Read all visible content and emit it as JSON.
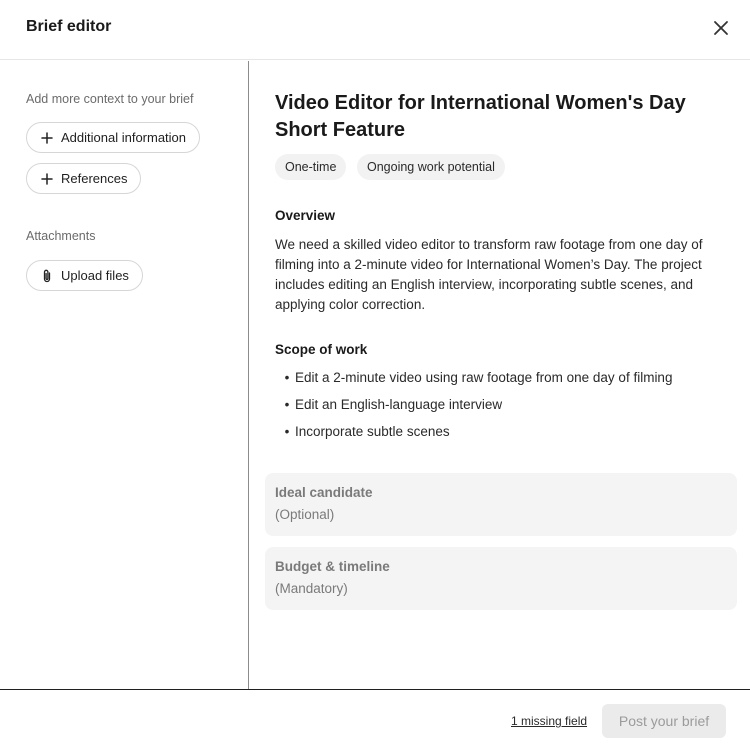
{
  "header": {
    "title": "Brief editor",
    "close_icon": "close-icon"
  },
  "sidebar": {
    "context_label": "Add more context to your brief",
    "additional_info_label": "Additional information",
    "references_label": "References",
    "attachments_label": "Attachments",
    "upload_label": "Upload files"
  },
  "main": {
    "title": "Video Editor for International Women's Day Short Feature",
    "tags": [
      "One-time",
      "Ongoing work potential"
    ],
    "overview_heading": "Overview",
    "overview_text": "We need a skilled video editor to transform raw footage from one day of filming into a 2-minute video for International Women’s Day. The project includes editing an English interview, incorporating subtle scenes, and applying color correction.",
    "scope_heading": "Scope of work",
    "scope_items": [
      "Edit a 2-minute video using raw footage from one day of filming",
      "Edit an English-language interview",
      "Incorporate subtle scenes"
    ],
    "ideal_candidate": {
      "heading": "Ideal candidate",
      "sub": "(Optional)"
    },
    "budget_timeline": {
      "heading": "Budget & timeline",
      "sub": "(Mandatory)"
    }
  },
  "footer": {
    "missing_field_label": "1 missing field",
    "post_label": "Post your brief"
  },
  "colors": {
    "border": "#e6e6e6",
    "card_bg": "#f4f4f4",
    "disabled_btn_bg": "#ebebeb",
    "disabled_text": "#9b9b9b"
  }
}
